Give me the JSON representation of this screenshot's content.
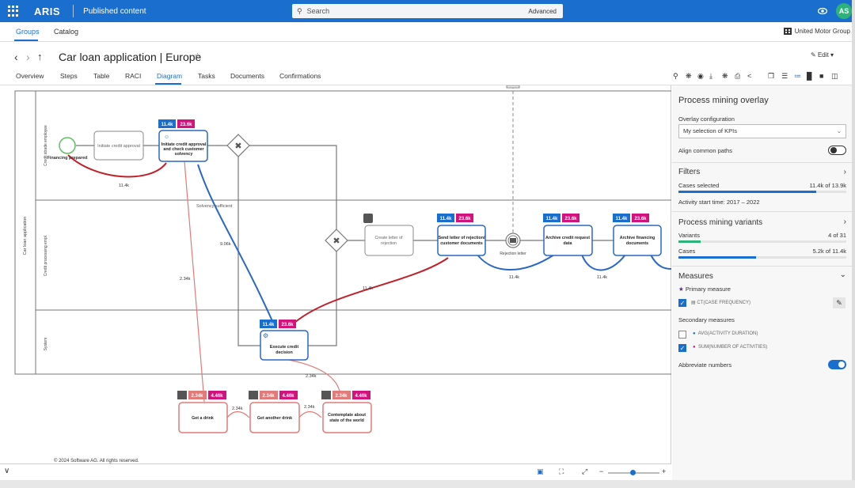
{
  "app": {
    "brand": "ARIS",
    "section": "Published content",
    "search_placeholder": "Search",
    "advanced": "Advanced",
    "user_initials": "AS"
  },
  "subnav": {
    "tabs": [
      "Groups",
      "Catalog"
    ],
    "org": "United Motor Group"
  },
  "page": {
    "title": "Car loan application | Europe",
    "edit": "Edit"
  },
  "tabs": [
    "Overview",
    "Steps",
    "Table",
    "RACI",
    "Diagram",
    "Tasks",
    "Documents",
    "Confirmations"
  ],
  "diagram": {
    "pool": "Car loan application",
    "lanes": [
      "Credit strade employee",
      "Credit processing empl.",
      "System"
    ],
    "start_event": "Financing prepared",
    "nodes": {
      "initiate_short": "Initiate credit approval",
      "initiate": "Initiate credit approval and check customer solvency",
      "create_letter": "Create letter of rejection",
      "send_letter": "Send letter of rejection/ customer documents",
      "rejection_letter": "Rejection letter",
      "archive_request": "Archive credit request data",
      "archive_financing": "Archive financing documents",
      "execute": "Execute credit decision",
      "get_drink": "Get a drink",
      "another_drink": "Get another drink",
      "contemplate": "Contemplate about state of the world"
    },
    "gateway_label": "Solvency sufficient",
    "kpi_blue": "11.4k",
    "kpi_pink": "23.6k",
    "kpi_coral": "2.34k",
    "kpi_coral2": "4.46k",
    "edges": {
      "e1": "11.4k",
      "e2": "9.06k",
      "e3": "2.34k",
      "e4": "11.4k",
      "e5": "11.4k",
      "e6": "11.4k",
      "e7": "2.34k",
      "e8": "2.34k",
      "e9": "2.34k"
    }
  },
  "footer": {
    "copyright": "© 2024 Software AG. All rights reserved."
  },
  "panel": {
    "title": "Process mining overlay",
    "overlay_config": "Overlay configuration",
    "overlay_select": "My selection of KPIs",
    "align": "Align common paths",
    "filters": "Filters",
    "cases_selected": "Cases selected",
    "cases_selected_val": "11.4k of 13.9k",
    "cases_selected_frac": 0.82,
    "activity_time": "Activity start time: 2017 – 2022",
    "variants_title": "Process mining variants",
    "variants": "Variants",
    "variants_val": "4 of 31",
    "variants_frac": 0.13,
    "cases": "Cases",
    "cases_val": "5.2k of 11.4k",
    "cases_frac": 0.46,
    "measures": "Measures",
    "primary": "Primary measure",
    "primary_item": "CT(CASE FREQUENCY)",
    "secondary": "Secondary measures",
    "sec1": "AVG(ACTIVITY DURATION)",
    "sec2": "SUM(NUMBER OF ACTIVITIES)",
    "abbrev": "Abbreviate numbers"
  },
  "colors": {
    "accent": "#1a6fce",
    "kpi_pink": "#d4127e",
    "coral": "#e27a7a",
    "red_edge": "#c0202a",
    "blue_edge": "#2a66c4",
    "green": "#2bb37a"
  }
}
